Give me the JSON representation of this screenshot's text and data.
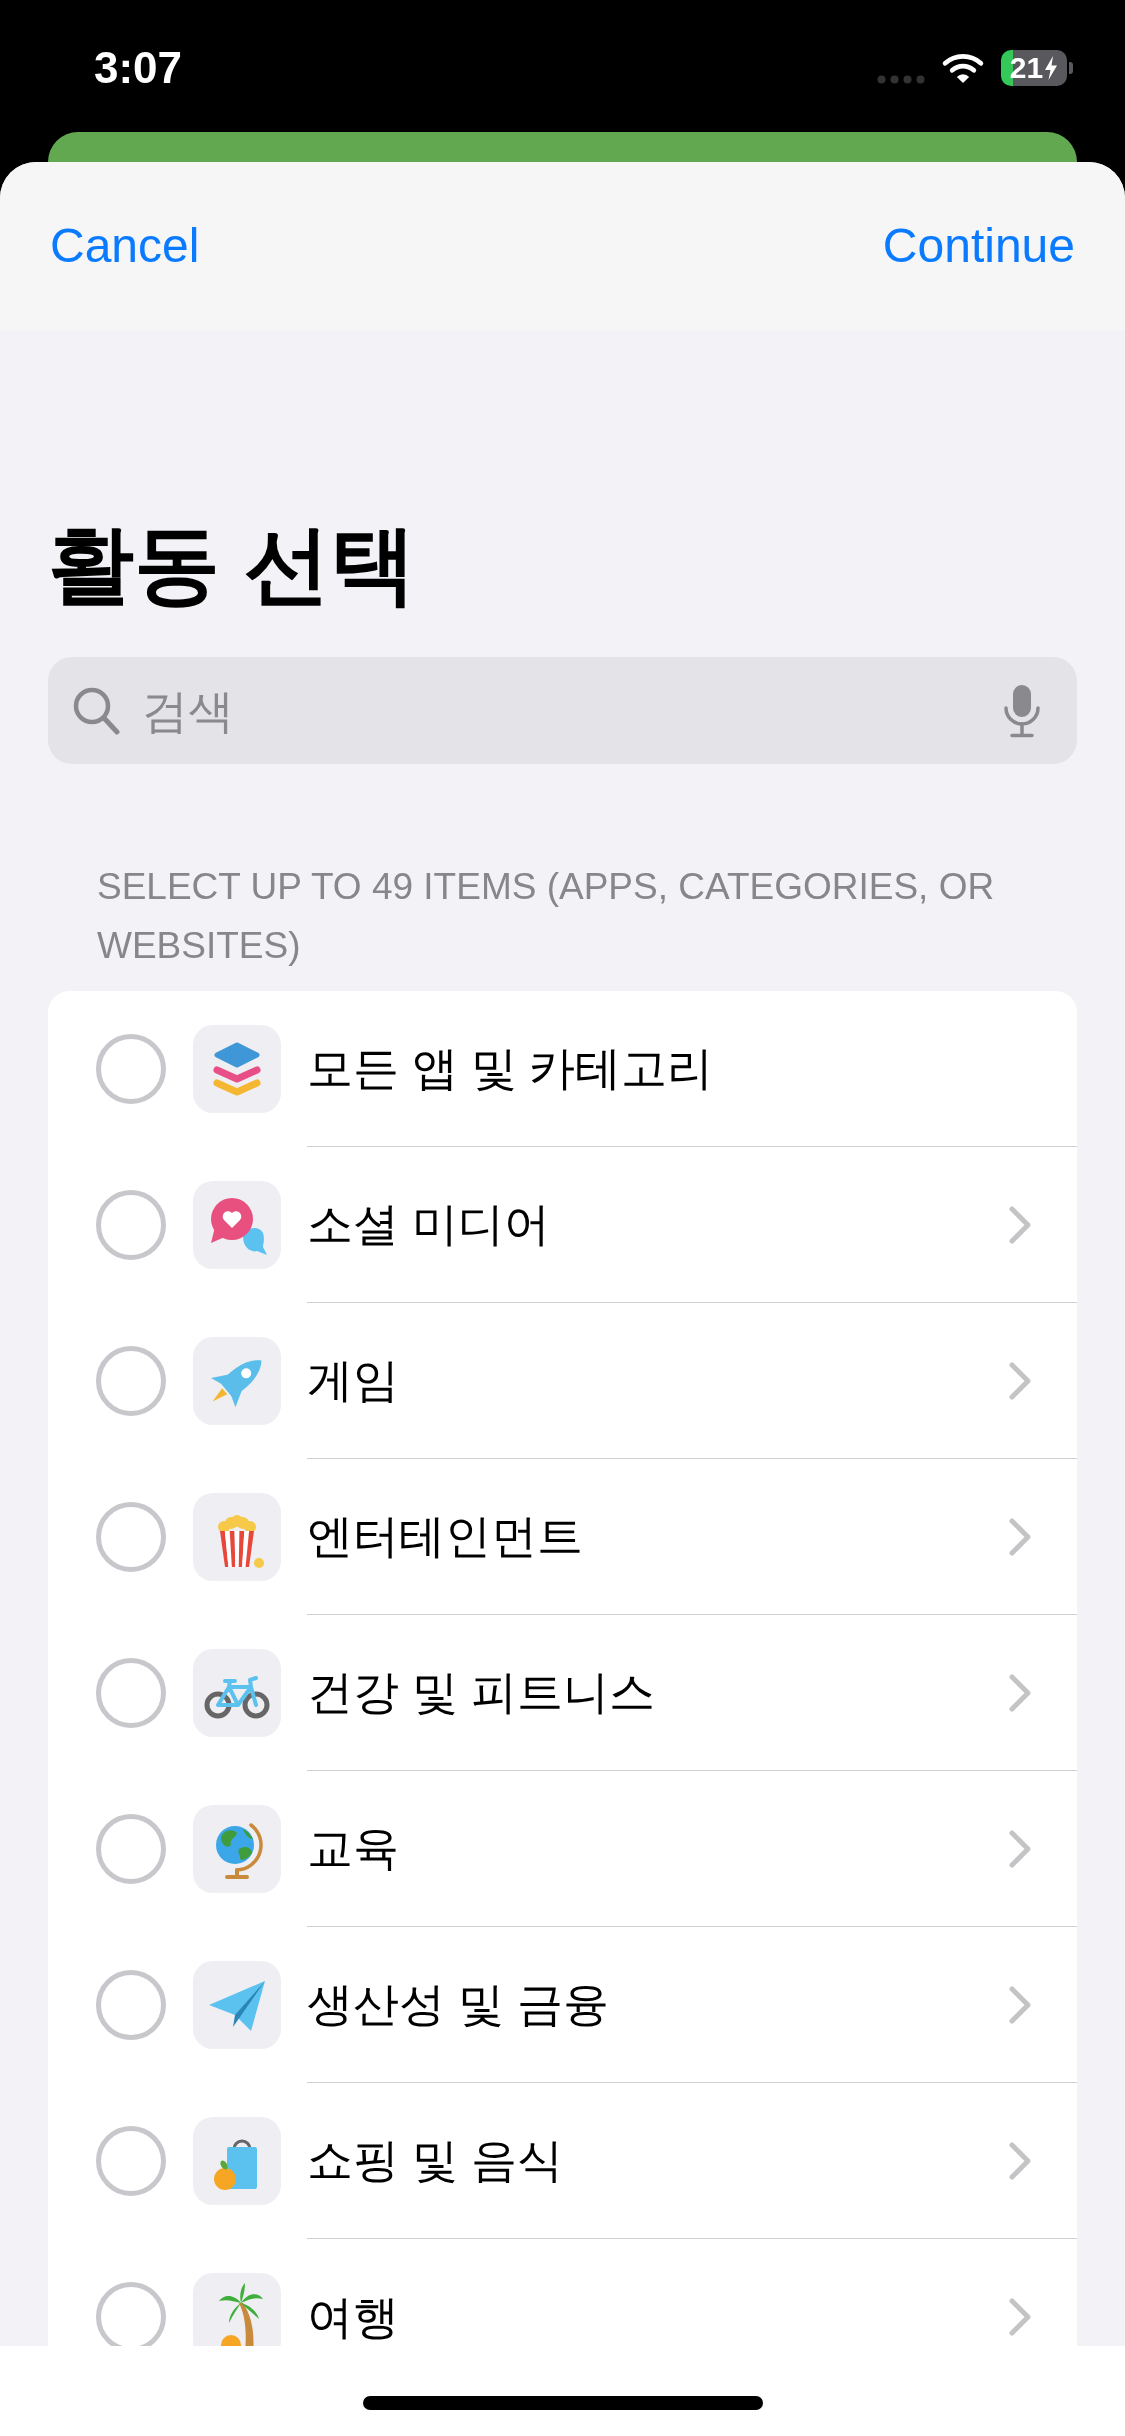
{
  "status_bar": {
    "time": "3:07",
    "battery": "21"
  },
  "nav_bar": {
    "cancel": "Cancel",
    "continue": "Continue"
  },
  "title": "활동 선택",
  "search": {
    "placeholder": "검색"
  },
  "section_header": "SELECT UP TO 49 ITEMS (APPS, CATEGORIES, OR WEBSITES)",
  "items": [
    {
      "label": "모든 앱 및 카테고리",
      "kind": "all",
      "selected": false,
      "disclosure": false
    },
    {
      "label": "소셜 미디어",
      "kind": "social",
      "selected": false,
      "disclosure": true
    },
    {
      "label": "게임",
      "kind": "games",
      "selected": false,
      "disclosure": true
    },
    {
      "label": "엔터테인먼트",
      "kind": "entertainment",
      "selected": false,
      "disclosure": true
    },
    {
      "label": "건강 및 피트니스",
      "kind": "health",
      "selected": false,
      "disclosure": true
    },
    {
      "label": "교육",
      "kind": "education",
      "selected": false,
      "disclosure": true
    },
    {
      "label": "생산성 및 금융",
      "kind": "productivity",
      "selected": false,
      "disclosure": true
    },
    {
      "label": "쇼핑 및 음식",
      "kind": "shopping",
      "selected": false,
      "disclosure": true
    },
    {
      "label": "여행",
      "kind": "travel",
      "selected": false,
      "disclosure": true
    }
  ]
}
